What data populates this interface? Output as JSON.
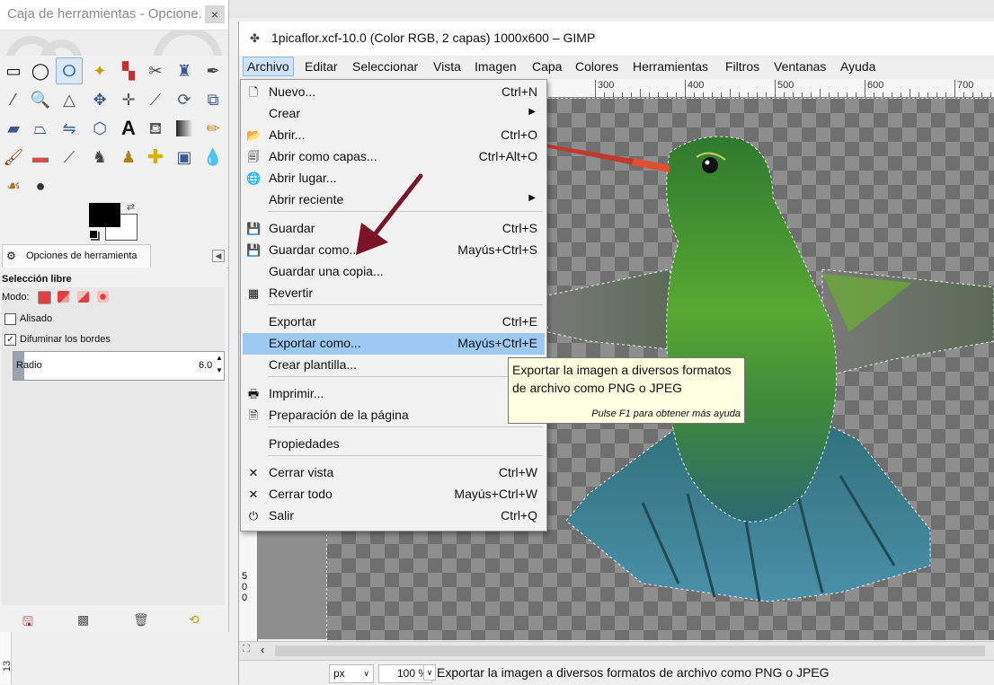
{
  "toolbox": {
    "title": "Caja de herramientas - Opcione...",
    "close": "×",
    "tab_label": "Opciones de herramienta",
    "tool_name": "Selección libre",
    "mode_label": "Modo:",
    "antialias_label": "Alisado",
    "antialias_checked": false,
    "feather_label": "Difuminar los bordes",
    "feather_checked": true,
    "radius_label": "Radio",
    "radius_value": "6.0",
    "fg_color": "#000000",
    "bg_color": "#ffffff"
  },
  "window": {
    "title": "1picaflor.xcf-10.0 (Color RGB, 2 capas) 1000x600 – GIMP",
    "menus": [
      "Archivo",
      "Editar",
      "Seleccionar",
      "Vista",
      "Imagen",
      "Capa",
      "Colores",
      "Herramientas",
      "Filtros",
      "Ventanas",
      "Ayuda"
    ],
    "ruler_labels": [
      "300",
      "400",
      "500",
      "600",
      "700"
    ],
    "ruler_left_labels": [
      "5",
      "0",
      "0"
    ],
    "unit": "px",
    "zoom": "100 %",
    "status": "Exportar la imagen a diversos formatos de archivo como PNG o JPEG"
  },
  "menu": {
    "items": [
      {
        "label": "Nuevo...",
        "shortcut": "Ctrl+N",
        "icon": "new-file-icon",
        "glyph": "🗋"
      },
      {
        "label": "Crear",
        "shortcut": "",
        "submenu": true,
        "icon": "",
        "glyph": ""
      },
      {
        "label": "Abrir...",
        "shortcut": "Ctrl+O",
        "icon": "open-folder-icon",
        "glyph": "📂"
      },
      {
        "label": "Abrir como capas...",
        "shortcut": "Ctrl+Alt+O",
        "icon": "open-layers-icon",
        "glyph": "🗐"
      },
      {
        "label": "Abrir lugar...",
        "shortcut": "",
        "icon": "globe-icon",
        "glyph": "🌐"
      },
      {
        "label": "Abrir reciente",
        "shortcut": "",
        "submenu": true,
        "icon": "",
        "glyph": ""
      },
      {
        "label": "Guardar",
        "shortcut": "Ctrl+S",
        "icon": "save-icon",
        "glyph": "💾"
      },
      {
        "label": "Guardar como...",
        "shortcut": "Mayús+Ctrl+S",
        "icon": "save-as-icon",
        "glyph": "💾"
      },
      {
        "label": "Guardar una copia...",
        "shortcut": "",
        "icon": "",
        "glyph": ""
      },
      {
        "label": "Revertir",
        "shortcut": "",
        "icon": "revert-icon",
        "glyph": "▦"
      },
      {
        "label": "Exportar",
        "shortcut": "Ctrl+E",
        "icon": "",
        "glyph": ""
      },
      {
        "label": "Exportar como...",
        "shortcut": "Mayús+Ctrl+E",
        "icon": "",
        "glyph": "",
        "highlighted": true
      },
      {
        "label": "Crear plantilla...",
        "shortcut": "",
        "icon": "",
        "glyph": ""
      },
      {
        "label": "Imprimir...",
        "shortcut": "C",
        "icon": "print-icon",
        "glyph": "🖶"
      },
      {
        "label": "Preparación de la página",
        "shortcut": "",
        "icon": "page-setup-icon",
        "glyph": "🗎"
      },
      {
        "label": "Propiedades",
        "shortcut": "",
        "icon": "",
        "glyph": ""
      },
      {
        "label": "Cerrar vista",
        "shortcut": "Ctrl+W",
        "icon": "close-view-icon",
        "glyph": "✕"
      },
      {
        "label": "Cerrar todo",
        "shortcut": "Mayús+Ctrl+W",
        "icon": "close-all-icon",
        "glyph": "✕"
      },
      {
        "label": "Salir",
        "shortcut": "Ctrl+Q",
        "icon": "quit-icon",
        "glyph": "⏻"
      }
    ]
  },
  "tooltip": {
    "line1": "Exportar la imagen a diversos formatos",
    "line2": "de archivo como PNG o JPEG",
    "hint": "Pulse F1 para obtener más ayuda"
  },
  "edge_number": "13",
  "colors": {
    "menu_highlight": "#9ccaf5",
    "arrow": "#7a1428",
    "tooltip_bg": "#ffffe1"
  }
}
